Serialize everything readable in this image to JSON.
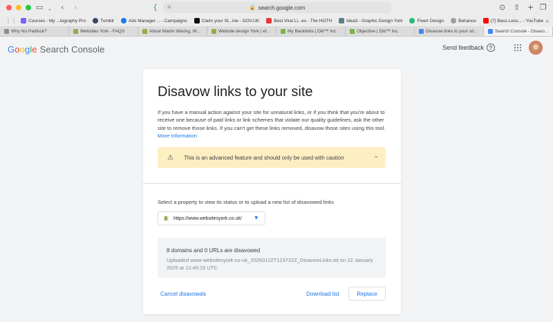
{
  "browser": {
    "url": "search.google.com",
    "bookmarks": [
      {
        "label": "Courses - My ...tography Pro",
        "color": "#7b61ff"
      },
      {
        "label": "Tumblr",
        "color": "#36465d"
      },
      {
        "label": "Ads Manager ... - Campaigns",
        "color": "#1877f2"
      },
      {
        "label": "Claim your St...ine - GOV.UK",
        "color": "#0b0c0c"
      },
      {
        "label": "Best Viral Li...es - The HOTH",
        "color": "#e53935"
      },
      {
        "label": "Idea3 - Graphic Design York",
        "color": "#607d8b"
      },
      {
        "label": "Fiverr Design",
        "color": "#1dbf73"
      },
      {
        "label": "Behance",
        "color": "#9e9e9e"
      },
      {
        "label": "(7) Bass Less... - YouTube",
        "color": "#ff0000"
      }
    ],
    "tabs": [
      {
        "label": "Why No Padlock?",
        "color": "#8d8d8d",
        "active": false
      },
      {
        "label": "Websites York - FAQS",
        "color": "#9aa84a",
        "active": false
      },
      {
        "label": "About Martin Waring, W...",
        "color": "#9aa84a",
        "active": false
      },
      {
        "label": "Website design York | ef...",
        "color": "#9aa84a",
        "active": false
      },
      {
        "label": "My Backlinks | Dib™ Inc.",
        "color": "#7cb342",
        "active": false
      },
      {
        "label": "Objective | Dib™ Inc.",
        "color": "#7cb342",
        "active": false
      },
      {
        "label": "Disavow links to your sit...",
        "color": "#4285f4",
        "active": false
      },
      {
        "label": "Search Console - Disavo...",
        "color": "#4285f4",
        "active": true
      }
    ]
  },
  "header": {
    "logo_g": "G",
    "logo_o1": "o",
    "logo_o2": "o",
    "logo_g2": "g",
    "logo_l": "l",
    "logo_e": "e",
    "product": "Search Console",
    "send_feedback": "Send feedback",
    "help": "?"
  },
  "card": {
    "title": "Disavow links to your site",
    "intro": "If you have a manual action against your site for unnatural links, or if you think that you're about to receive one because of paid links or link schemes that violate our quality guidelines, ask the other site to remove those links. If you can't get these links removed, disavow those sites using this tool.",
    "more_info": "More information",
    "warning": "This is an advanced feature and should only be used with caution",
    "select_label": "Select a property to view its status or to upload a new list of disavowed links",
    "property": "https://www.websitesyork.co.uk/",
    "status_title": "8 domains and 0 URLs are disavowed",
    "status_detail": "Uploaded www-websitesyork-co-uk_20250122T123732Z_DisavowLinks.txt on 22 January 2025 at 12:40:15 UTC",
    "cancel": "Cancel disavowals",
    "download": "Download list",
    "replace": "Replace"
  },
  "colors": {
    "accent": "#1a73e8",
    "warning_bg": "#feefc3"
  }
}
